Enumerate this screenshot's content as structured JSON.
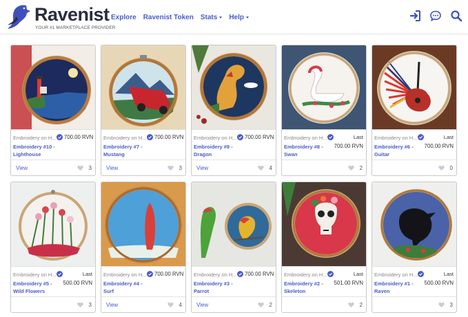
{
  "brand": {
    "name": "Ravenist",
    "tagline": "YOUR #1 MARKETPLACE PROVIDER"
  },
  "nav": {
    "explore": "Explore",
    "token": "Ravenist Token",
    "stats": "Stats",
    "help": "Help"
  },
  "nav_icons": [
    "login-icon",
    "chat-icon",
    "search-icon"
  ],
  "colors": {
    "accent": "#4a5bc8",
    "brand_dark": "#2a2d3e",
    "verified": "#4a5bc8"
  },
  "cards": [
    {
      "collection": "Embroidery on H...",
      "price_label": "",
      "price": "700.00 RVN",
      "name_line1": "Embroidery #10 -",
      "name_line2": "Lighthouse",
      "view": "View",
      "likes": "3"
    },
    {
      "collection": "Embroidery on H...",
      "price_label": "",
      "price": "700.00 RVN",
      "name_line1": "Embroidery #7 -",
      "name_line2": "Mustang",
      "view": "View",
      "likes": "3"
    },
    {
      "collection": "Embroidery on H...",
      "price_label": "",
      "price": "700.00 RVN",
      "name_line1": "Embroidery #9 -",
      "name_line2": "Dragon",
      "view": "View",
      "likes": "4"
    },
    {
      "collection": "Embroidery on H...",
      "price_label": "Last",
      "price": "700.00 RVN",
      "name_line1": "Embroidery #8 -",
      "name_line2": "Swan",
      "view": "",
      "likes": "2"
    },
    {
      "collection": "Embroidery on H...",
      "price_label": "Last",
      "price": "700.00 RVN",
      "name_line1": "Embroidery #6 -",
      "name_line2": "Guitar",
      "view": "",
      "likes": "0"
    },
    {
      "collection": "Embroidery on H...",
      "price_label": "Last",
      "price": "500.00 RVN",
      "name_line1": "Embroidery #5 -",
      "name_line2": "Wild Flowers",
      "view": "",
      "likes": "3"
    },
    {
      "collection": "Embroidery on H...",
      "price_label": "",
      "price": "700.00 RVN",
      "name_line1": "Embroidery #4 -",
      "name_line2": "Surf",
      "view": "View",
      "likes": "4"
    },
    {
      "collection": "Embroidery on H...",
      "price_label": "",
      "price": "700.00 RVN",
      "name_line1": "Embroidery #3 -",
      "name_line2": "Parrot",
      "view": "View",
      "likes": "2"
    },
    {
      "collection": "Embroidery on H...",
      "price_label": "Last",
      "price": "501.00 RVN",
      "name_line1": "Embroidery #2 -",
      "name_line2": "Skeleton",
      "view": "",
      "likes": "2"
    },
    {
      "collection": "Embroidery on H...",
      "price_label": "Last",
      "price": "500.00 RVN",
      "name_line1": "Embroidery #1 -",
      "name_line2": "Raven",
      "view": "",
      "likes": "3"
    }
  ]
}
